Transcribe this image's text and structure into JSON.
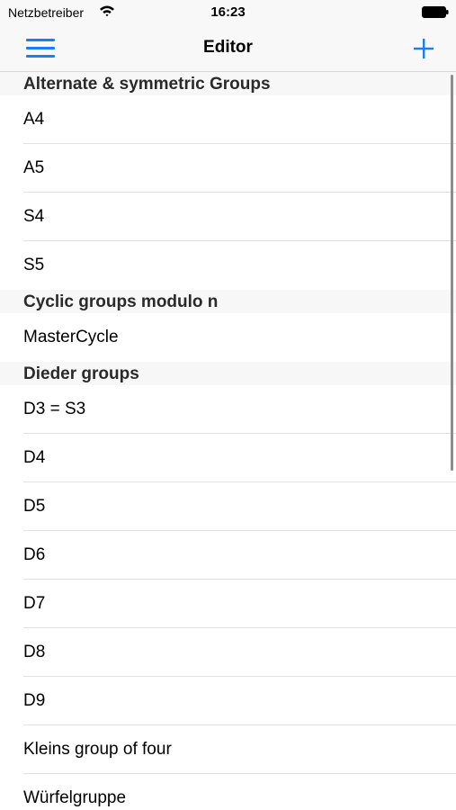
{
  "status_bar": {
    "carrier": "Netzbetreiber",
    "time": "16:23"
  },
  "nav": {
    "title": "Editor",
    "accent_color": "#1580f9"
  },
  "sections": [
    {
      "header": "Alternate & symmetric Groups",
      "items": [
        "A4",
        "A5",
        "S4",
        "S5"
      ]
    },
    {
      "header": "Cyclic groups modulo n",
      "items": [
        "MasterCycle"
      ]
    },
    {
      "header": "Dieder groups",
      "items": [
        "D3 = S3",
        "D4",
        "D5",
        "D6",
        "D7",
        "D8",
        "D9",
        "Kleins group of four",
        "Würfelgruppe"
      ]
    }
  ]
}
